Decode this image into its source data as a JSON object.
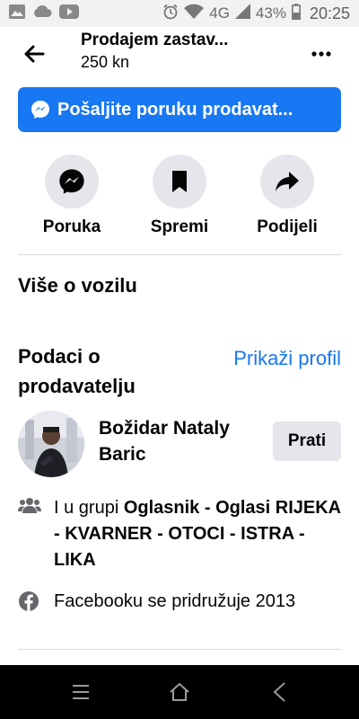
{
  "status_bar": {
    "network": "4G",
    "battery": "43%",
    "time": "20:25",
    "left_icons": [
      "image-icon",
      "cloud-icon",
      "youtube-icon"
    ],
    "right_icons": [
      "alarm-icon",
      "wifi-icon",
      "signal-icon",
      "battery-icon"
    ]
  },
  "header": {
    "title": "Prodajem  zastav...",
    "price": "250 kn"
  },
  "message_button": {
    "label": "Pošaljite poruku prodavat..."
  },
  "actions": [
    {
      "label": "Poruka",
      "icon": "messenger-icon"
    },
    {
      "label": "Spremi",
      "icon": "bookmark-icon"
    },
    {
      "label": "Podijeli",
      "icon": "share-icon"
    }
  ],
  "vehicle_section": {
    "title": "Više o vozilu"
  },
  "seller": {
    "heading": "Podaci o prodavatelju",
    "profile_link": "Prikaži profil",
    "name": "Božidar Nataly Baric",
    "follow_label": "Prati",
    "group_prefix": "I u grupi ",
    "group_name": "Oglasnik - Oglasi RIJEKA - KVARNER - OTOCI - ISTRA - LIKA",
    "joined": "Facebooku se pridružuje 2013"
  },
  "colors": {
    "accent": "#1877f2",
    "button_gray": "#e4e6eb",
    "text": "#050505"
  }
}
